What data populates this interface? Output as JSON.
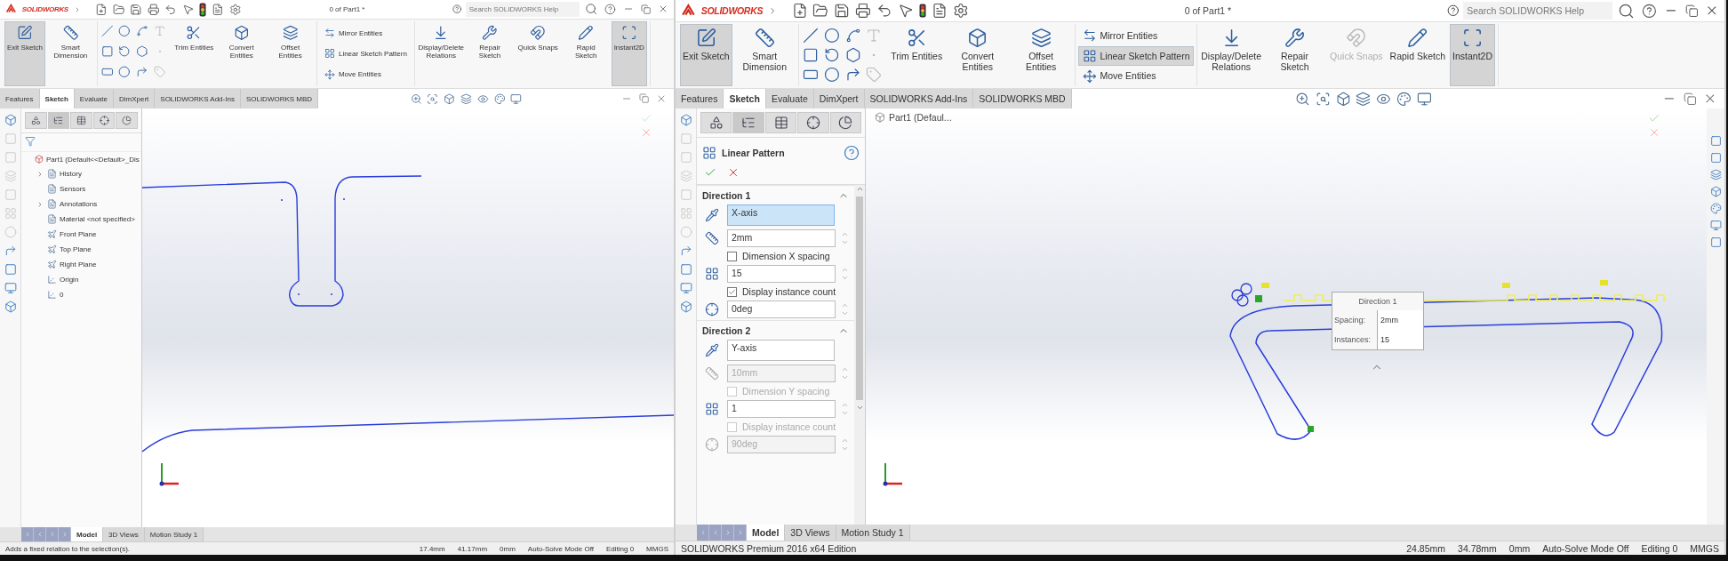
{
  "windows": [
    {
      "logo": "SOLIDWORKS",
      "title": "0 of Part1 *",
      "search": {
        "placeholder": "Search SOLIDWORKS Help"
      },
      "ribbon": {
        "tools": [
          {
            "label": "Exit Sketch",
            "selected": true,
            "disabled": false
          },
          {
            "label": "Smart Dimension",
            "selected": false,
            "disabled": false
          }
        ],
        "entities": [
          {
            "label": "Trim Entities",
            "selected": false,
            "disabled": false
          },
          {
            "label": "Convert Entities",
            "selected": false,
            "disabled": false
          },
          {
            "label": "Offset Entities",
            "selected": false,
            "disabled": false
          }
        ],
        "list": [
          {
            "label": "Mirror Entities",
            "selected": false
          },
          {
            "label": "Linear Sketch Pattern",
            "selected": false
          },
          {
            "label": "Move Entities",
            "selected": false
          }
        ],
        "relations": [
          {
            "label": "Display/Delete Relations",
            "selected": false,
            "disabled": false
          },
          {
            "label": "Repair Sketch",
            "selected": false,
            "disabled": false
          },
          {
            "label": "Quick Snaps",
            "selected": false,
            "disabled": false
          },
          {
            "label": "Rapid Sketch",
            "selected": false,
            "disabled": false
          },
          {
            "label": "Instant2D",
            "selected": true,
            "disabled": false
          }
        ]
      },
      "tabs": [
        {
          "label": "Features",
          "selected": false
        },
        {
          "label": "Sketch",
          "selected": true
        },
        {
          "label": "Evaluate",
          "selected": false
        },
        {
          "label": "DimXpert",
          "selected": false
        },
        {
          "label": "SOLIDWORKS Add-Ins",
          "selected": false
        },
        {
          "label": "SOLIDWORKS MBD",
          "selected": false
        }
      ],
      "panel": {
        "kind": "tree",
        "root": {
          "label": "Part1  (Default<<Default>_Dis",
          "children": [
            {
              "label": "History",
              "collapsed": true
            },
            {
              "label": "Sensors",
              "collapsed": false
            },
            {
              "label": "Annotations",
              "collapsed": true
            },
            {
              "label": "Material <not specified>",
              "collapsed": false
            },
            {
              "label": "Front Plane",
              "collapsed": false
            },
            {
              "label": "Top Plane",
              "collapsed": false
            },
            {
              "label": "Right Plane",
              "collapsed": false
            },
            {
              "label": "Origin",
              "collapsed": false
            },
            {
              "label": "0",
              "collapsed": false
            }
          ]
        }
      },
      "canvas": {
        "kind": "slot"
      },
      "bottom_tabs": [
        {
          "label": "Model",
          "selected": true
        },
        {
          "label": "3D Views",
          "selected": false
        },
        {
          "label": "Motion Study 1",
          "selected": false
        }
      ],
      "status": {
        "message": "Adds a fixed relation to the selection(s).",
        "readouts": [
          "17.4mm",
          "41.17mm",
          "0mm",
          "Auto-Solve Mode Off",
          "Editing 0",
          "MMGS"
        ]
      }
    },
    {
      "logo": "SOLIDWORKS",
      "title": "0 of Part1 *",
      "search": {
        "placeholder": "Search SOLIDWORKS Help"
      },
      "ribbon": {
        "tools": [
          {
            "label": "Exit Sketch",
            "selected": true,
            "disabled": false
          },
          {
            "label": "Smart Dimension",
            "selected": false,
            "disabled": false
          }
        ],
        "entities": [
          {
            "label": "Trim Entities",
            "selected": false,
            "disabled": false
          },
          {
            "label": "Convert Entities",
            "selected": false,
            "disabled": false
          },
          {
            "label": "Offset Entities",
            "selected": false,
            "disabled": false
          }
        ],
        "list": [
          {
            "label": "Mirror Entities",
            "selected": false
          },
          {
            "label": "Linear Sketch Pattern",
            "selected": true
          },
          {
            "label": "Move Entities",
            "selected": false
          }
        ],
        "relations": [
          {
            "label": "Display/Delete Relations",
            "selected": false,
            "disabled": false
          },
          {
            "label": "Repair Sketch",
            "selected": false,
            "disabled": false
          },
          {
            "label": "Quick Snaps",
            "selected": false,
            "disabled": true
          },
          {
            "label": "Rapid Sketch",
            "selected": false,
            "disabled": false
          },
          {
            "label": "Instant2D",
            "selected": true,
            "disabled": false
          }
        ]
      },
      "tabs": [
        {
          "label": "Features",
          "selected": false
        },
        {
          "label": "Sketch",
          "selected": true
        },
        {
          "label": "Evaluate",
          "selected": false
        },
        {
          "label": "DimXpert",
          "selected": false
        },
        {
          "label": "SOLIDWORKS Add-Ins",
          "selected": false
        },
        {
          "label": "SOLIDWORKS MBD",
          "selected": false
        }
      ],
      "panel": {
        "kind": "property_manager",
        "title": "Linear Pattern",
        "sections": [
          {
            "title": "Direction 1",
            "rows": [
              {
                "kind": "axis",
                "value": "X-axis",
                "focused": true,
                "disabled": false
              },
              {
                "kind": "spacing",
                "value": "2mm",
                "disabled": false
              },
              {
                "kind": "check",
                "label": "Dimension X spacing",
                "checked": false,
                "disabled": false
              },
              {
                "kind": "count",
                "value": "15",
                "disabled": false
              },
              {
                "kind": "check",
                "label": "Display instance count",
                "checked": true,
                "disabled": false
              },
              {
                "kind": "angle",
                "value": "0deg",
                "disabled": false
              }
            ]
          },
          {
            "title": "Direction 2",
            "rows": [
              {
                "kind": "axis",
                "value": "Y-axis",
                "focused": false,
                "disabled": false
              },
              {
                "kind": "spacing",
                "value": "10mm",
                "disabled": true
              },
              {
                "kind": "check",
                "label": "Dimension Y spacing",
                "checked": false,
                "disabled": true
              },
              {
                "kind": "count",
                "value": "1",
                "disabled": false
              },
              {
                "kind": "check",
                "label": "Display instance count",
                "checked": false,
                "disabled": true
              },
              {
                "kind": "angle",
                "value": "90deg",
                "disabled": true
              }
            ]
          }
        ]
      },
      "canvas": {
        "kind": "pattern",
        "header": "Part1  (Defaul...",
        "popup": {
          "title": "Direction 1",
          "fields": [
            {
              "label": "Spacing:",
              "value": "2mm"
            },
            {
              "label": "Instances:",
              "value": "15"
            }
          ]
        }
      },
      "bottom_tabs": [
        {
          "label": "Model",
          "selected": true
        },
        {
          "label": "3D Views",
          "selected": false
        },
        {
          "label": "Motion Study 1",
          "selected": false
        }
      ],
      "status": {
        "message": "SOLIDWORKS Premium 2016 x64 Edition",
        "readouts": [
          "24.85mm",
          "34.78mm",
          "0mm",
          "Auto-Solve Mode Off",
          "Editing 0",
          "MMGS"
        ]
      }
    }
  ]
}
